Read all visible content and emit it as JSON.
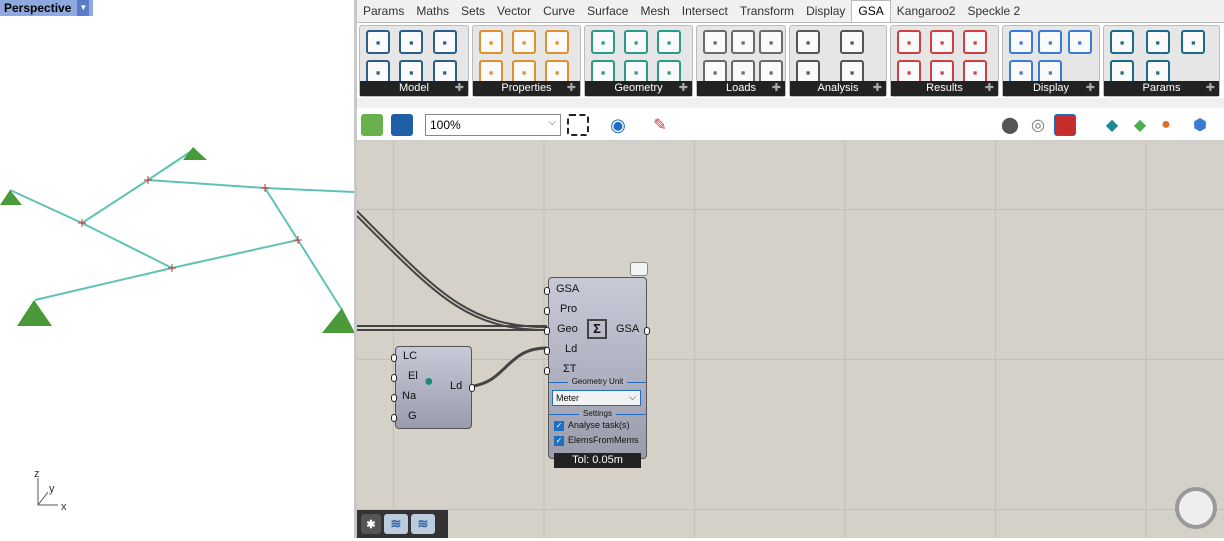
{
  "viewport": {
    "label": "Perspective",
    "axes": {
      "x": "x",
      "y": "y",
      "z": "z"
    }
  },
  "tabs": [
    "Params",
    "Maths",
    "Sets",
    "Vector",
    "Curve",
    "Surface",
    "Mesh",
    "Intersect",
    "Transform",
    "Display",
    "GSA",
    "Kangaroo2",
    "Speckle 2"
  ],
  "active_tab": "GSA",
  "panels": [
    {
      "label": "Model",
      "icons": [
        "open-model",
        "grid-model",
        "add-list",
        "save-model",
        "get-model",
        "update-list"
      ]
    },
    {
      "label": "Properties",
      "icons": [
        "create-prop2d",
        "create-section",
        "create-prop3d",
        "edit-prop2d",
        "edit-section",
        "edit-prop3d"
      ]
    },
    {
      "label": "Geometry",
      "icons": [
        "create-support",
        "create-element1d",
        "create-element2d",
        "edit-node",
        "create-member2d",
        "create-member3d"
      ]
    },
    {
      "label": "Loads",
      "icons": [
        "create-load",
        "create-face-load",
        "create-node-load",
        "grid-load-thermal",
        "face-load-thermal",
        "edit-load"
      ]
    },
    {
      "label": "Analysis",
      "icons": [
        "analyse",
        "combination-case",
        "analysis-case",
        "analysis-task"
      ]
    },
    {
      "label": "Results",
      "icons": [
        "select-result",
        "node-displacement",
        "beam-forces",
        "result-info",
        "reaction-forces",
        "beam-diagram"
      ]
    },
    {
      "label": "Display",
      "icons": [
        "grid-annotation",
        "layers",
        "support-display",
        "grid-add",
        "layers-add"
      ]
    },
    {
      "label": "Params",
      "icons": [
        "gsa-model-param",
        "section-param",
        "element-param",
        "prop-param",
        "member-param"
      ]
    }
  ],
  "toolbar": {
    "zoom": "100%"
  },
  "components": {
    "load": {
      "inputs": [
        "LC",
        "El",
        "Na",
        "G"
      ],
      "output": "Ld"
    },
    "analyse": {
      "inputs": [
        "GSA",
        "Pro",
        "Geo",
        "Ld",
        "ΣT"
      ],
      "output": "GSA",
      "unit_header": "Geometry Unit",
      "unit": "Meter",
      "settings_header": "Settings",
      "options": [
        {
          "label": "Analyse task(s)",
          "checked": true
        },
        {
          "label": "ElemsFromMems",
          "checked": true
        }
      ],
      "status": "Tol: 0.05m"
    }
  }
}
